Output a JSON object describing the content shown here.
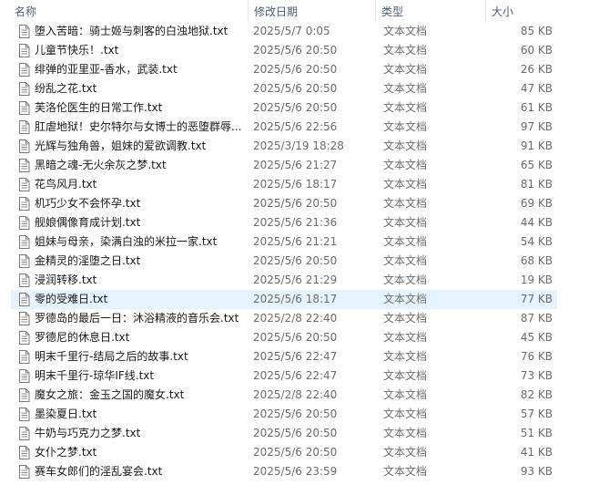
{
  "columns": {
    "name": "名称",
    "date": "修改日期",
    "type": "类型",
    "size": "大小"
  },
  "sort_icon": "chevron-up-icon",
  "selected_color": "#e5f3ff",
  "files": [
    {
      "name": "堕入苦暗：骑士姬与刺客的白浊地狱.txt",
      "date": "2025/5/7 0:05",
      "type": "文本文档",
      "size": "85 KB"
    },
    {
      "name": "儿童节快乐！.txt",
      "date": "2025/5/6 20:50",
      "type": "文本文档",
      "size": "60 KB"
    },
    {
      "name": "绯弹的亚里亚-香水，武装.txt",
      "date": "2025/5/6 20:50",
      "type": "文本文档",
      "size": "26 KB"
    },
    {
      "name": "纷乱之花.txt",
      "date": "2025/5/6 20:50",
      "type": "文本文档",
      "size": "47 KB"
    },
    {
      "name": "芙洛伦医生的日常工作.txt",
      "date": "2025/5/6 20:50",
      "type": "文本文档",
      "size": "61 KB"
    },
    {
      "name": "肛虐地狱！史尔特尔与女博士的恶堕群辱...",
      "date": "2025/5/6 22:56",
      "type": "文本文档",
      "size": "97 KB"
    },
    {
      "name": "光辉与独角兽，姐妹的爱欲调教.txt",
      "date": "2025/3/19 18:28",
      "type": "文本文档",
      "size": "91 KB"
    },
    {
      "name": "黑暗之魂-无火余灰之梦.txt",
      "date": "2025/5/6 21:27",
      "type": "文本文档",
      "size": "65 KB"
    },
    {
      "name": "花鸟风月.txt",
      "date": "2025/5/6 18:17",
      "type": "文本文档",
      "size": "81 KB"
    },
    {
      "name": "机巧少女不会怀孕.txt",
      "date": "2025/5/6 20:50",
      "type": "文本文档",
      "size": "69 KB"
    },
    {
      "name": "舰娘偶像育成计划.txt",
      "date": "2025/5/6 21:36",
      "type": "文本文档",
      "size": "44 KB"
    },
    {
      "name": "姐妹与母亲，染满白浊的米拉一家.txt",
      "date": "2025/5/6 21:21",
      "type": "文本文档",
      "size": "54 KB"
    },
    {
      "name": "金精灵的淫堕之日.txt",
      "date": "2025/5/6 20:50",
      "type": "文本文档",
      "size": "68 KB"
    },
    {
      "name": "浸润转移.txt",
      "date": "2025/5/6 21:29",
      "type": "文本文档",
      "size": "19 KB"
    },
    {
      "name": "零的受难日.txt",
      "date": "2025/5/6 18:17",
      "type": "文本文档",
      "size": "77 KB",
      "selected": true
    },
    {
      "name": "罗德岛的最后一日：沐浴精液的音乐会.txt",
      "date": "2025/2/8 22:40",
      "type": "文本文档",
      "size": "87 KB"
    },
    {
      "name": "罗德尼的休息日.txt",
      "date": "2025/5/6 20:50",
      "type": "文本文档",
      "size": "45 KB"
    },
    {
      "name": "明末千里行-结局之后的故事.txt",
      "date": "2025/5/6 22:47",
      "type": "文本文档",
      "size": "76 KB"
    },
    {
      "name": "明末千里行-琼华IF线.txt",
      "date": "2025/5/6 22:47",
      "type": "文本文档",
      "size": "73 KB"
    },
    {
      "name": "魔女之旅：金玉之国的魔女.txt",
      "date": "2025/2/8 22:40",
      "type": "文本文档",
      "size": "82 KB"
    },
    {
      "name": "墨染夏日.txt",
      "date": "2025/5/6 20:50",
      "type": "文本文档",
      "size": "57 KB"
    },
    {
      "name": "牛奶与巧克力之梦.txt",
      "date": "2025/5/6 20:50",
      "type": "文本文档",
      "size": "51 KB"
    },
    {
      "name": "女仆之梦.txt",
      "date": "2025/5/6 20:50",
      "type": "文本文档",
      "size": "41 KB"
    },
    {
      "name": "赛车女郎们的淫乱宴会.txt",
      "date": "2025/5/6 23:59",
      "type": "文本文档",
      "size": "93 KB"
    }
  ]
}
